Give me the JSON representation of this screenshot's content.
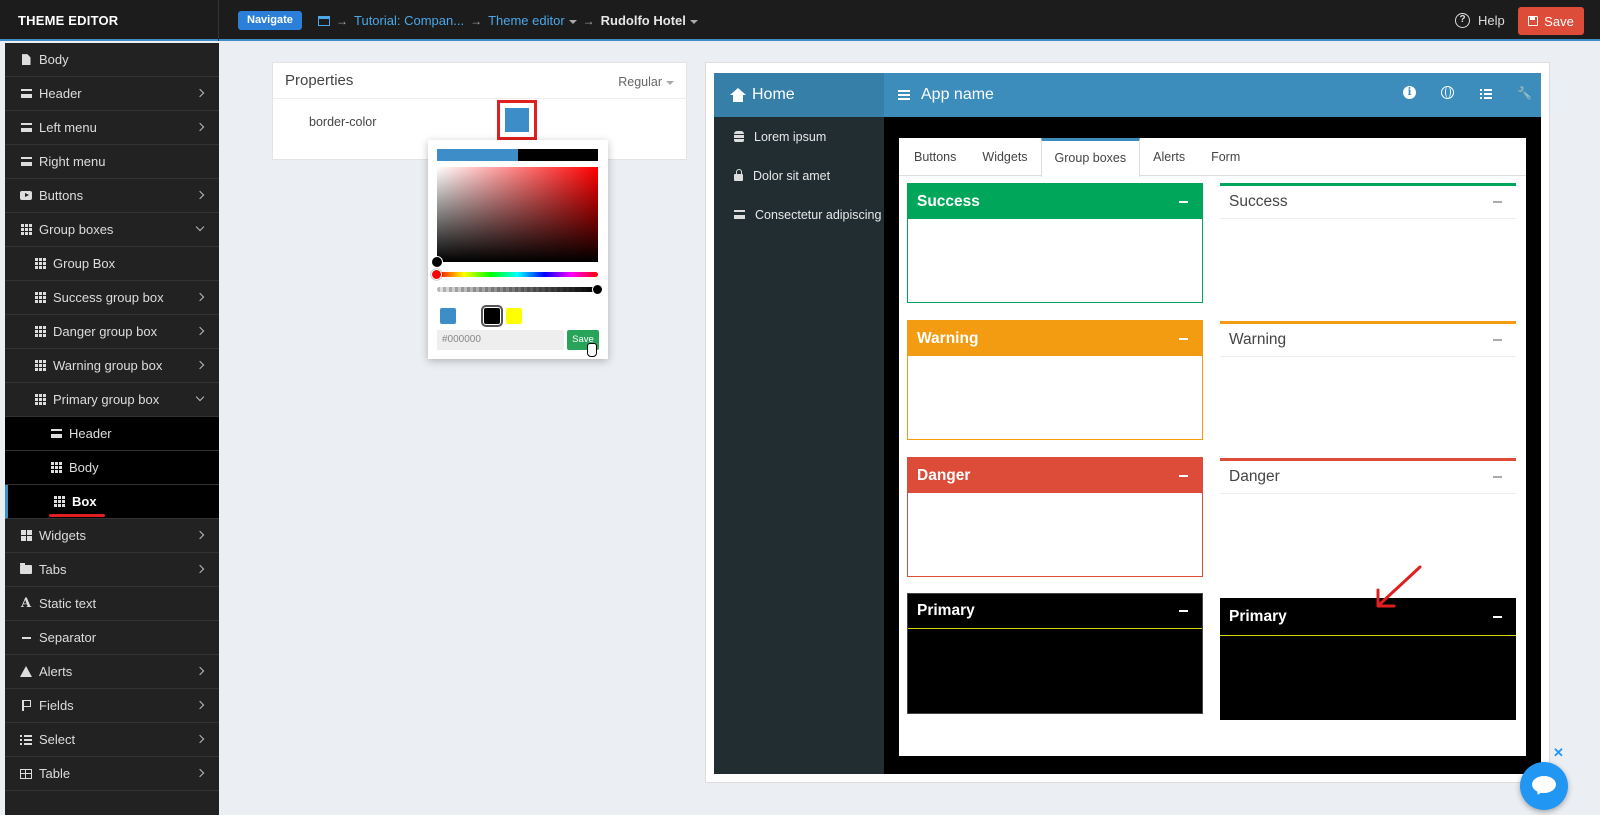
{
  "topbar": {
    "brand": "THEME EDITOR",
    "navigate_label": "Navigate",
    "breadcrumbs": [
      "Tutorial: Compan...",
      "Theme editor",
      "Rudolfo Hotel"
    ],
    "help_label": "Help",
    "save_label": "Save"
  },
  "sidebar": {
    "items": [
      {
        "label": "Body",
        "icon": "file-icon",
        "level": 1,
        "chevron": "none"
      },
      {
        "label": "Header",
        "icon": "bars-icon",
        "level": 1,
        "chevron": "right"
      },
      {
        "label": "Left menu",
        "icon": "align-left-icon",
        "level": 1,
        "chevron": "right"
      },
      {
        "label": "Right menu",
        "icon": "align-right-icon",
        "level": 1,
        "chevron": "none"
      },
      {
        "label": "Buttons",
        "icon": "play-button-icon",
        "level": 1,
        "chevron": "right"
      },
      {
        "label": "Group boxes",
        "icon": "grid-icon",
        "level": 1,
        "chevron": "down"
      },
      {
        "label": "Group Box",
        "icon": "grid-icon",
        "level": 2,
        "chevron": "none"
      },
      {
        "label": "Success group box",
        "icon": "grid-icon",
        "level": 2,
        "chevron": "right"
      },
      {
        "label": "Danger group box",
        "icon": "grid-icon",
        "level": 2,
        "chevron": "right"
      },
      {
        "label": "Warning group box",
        "icon": "grid-icon",
        "level": 2,
        "chevron": "right"
      },
      {
        "label": "Primary group box",
        "icon": "grid-icon",
        "level": 2,
        "chevron": "down"
      },
      {
        "label": "Header",
        "icon": "bars-icon",
        "level": 3,
        "chevron": "none"
      },
      {
        "label": "Body",
        "icon": "grid-icon",
        "level": 3,
        "chevron": "none"
      },
      {
        "label": "Box",
        "icon": "grid-icon",
        "level": 3,
        "chevron": "none",
        "active": true
      },
      {
        "label": "Widgets",
        "icon": "squares-icon",
        "level": 1,
        "chevron": "right"
      },
      {
        "label": "Tabs",
        "icon": "folder-icon",
        "level": 1,
        "chevron": "right"
      },
      {
        "label": "Static text",
        "icon": "font-icon",
        "level": 1,
        "chevron": "none"
      },
      {
        "label": "Separator",
        "icon": "minus-icon",
        "level": 1,
        "chevron": "none"
      },
      {
        "label": "Alerts",
        "icon": "warning-icon",
        "level": 1,
        "chevron": "right"
      },
      {
        "label": "Fields",
        "icon": "flag-icon",
        "level": 1,
        "chevron": "right"
      },
      {
        "label": "Select",
        "icon": "list-icon",
        "level": 1,
        "chevron": "right"
      },
      {
        "label": "Table",
        "icon": "table-icon",
        "level": 1,
        "chevron": "right"
      }
    ]
  },
  "properties": {
    "title": "Properties",
    "mode": "Regular",
    "property_label": "border-color",
    "current_color": "#3d8ec8"
  },
  "color_picker": {
    "previous_color": "#3d8ec8",
    "new_color": "#000000",
    "swatches": [
      "#3d8ec8",
      "#ffffff",
      "#000000",
      "#ffff00"
    ],
    "selected_swatch": "#000000",
    "hex_value": "#000000",
    "save_label": "Save"
  },
  "preview": {
    "home_label": "Home",
    "app_name": "App name",
    "menu": [
      "Lorem ipsum",
      "Dolor sit amet",
      "Consectetur adipiscing"
    ],
    "tabs": [
      "Buttons",
      "Widgets",
      "Group boxes",
      "Alerts",
      "Form"
    ],
    "active_tab": "Group boxes",
    "boxes": {
      "success": {
        "title": "Success",
        "color": "#00a65a"
      },
      "warning": {
        "title": "Warning",
        "color": "#f39c12"
      },
      "danger": {
        "title": "Danger",
        "color": "#dd4b39"
      },
      "primary": {
        "title": "Primary",
        "color": "#000000"
      }
    }
  }
}
